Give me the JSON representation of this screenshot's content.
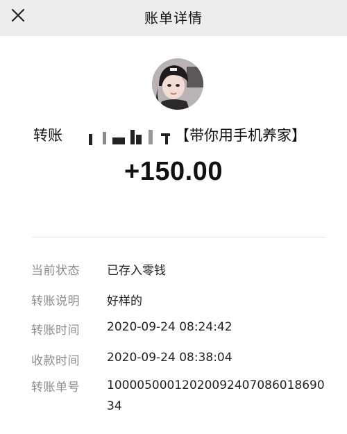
{
  "header": {
    "title": "账单详情",
    "close_icon": "close-icon"
  },
  "payer": {
    "prefix": "转账",
    "group_name": "【带你用手机养家】"
  },
  "amount": "+150.00",
  "details": [
    {
      "label": "当前状态",
      "value": "已存入零钱"
    },
    {
      "label": "转账说明",
      "value": "好样的"
    },
    {
      "label": "转账时间",
      "value": "2020-09-24 08:24:42"
    },
    {
      "label": "收款时间",
      "value": "2020-09-24 08:38:04"
    },
    {
      "label": "转账单号",
      "value": "1000050001202009240708601869034"
    }
  ],
  "colors": {
    "header_bg": "#ededed",
    "label": "#8c8c8c",
    "text": "#111111"
  }
}
